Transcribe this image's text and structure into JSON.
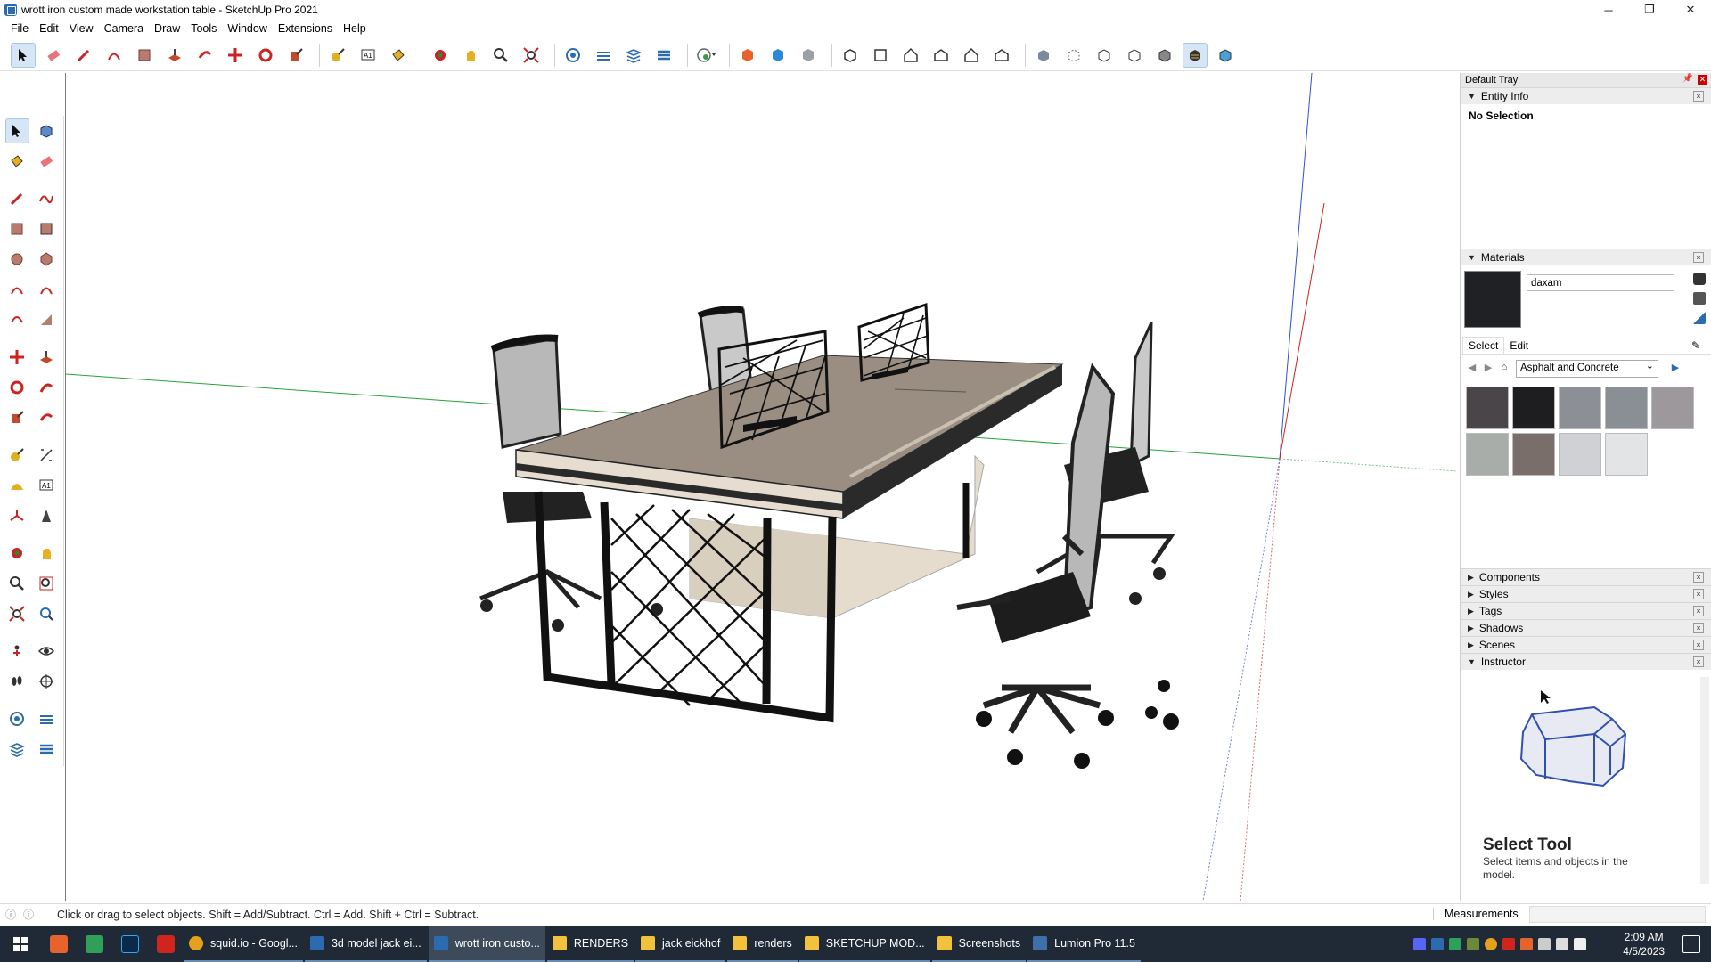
{
  "window": {
    "title": "wrott iron custom made workstation table - SketchUp Pro 2021",
    "controls": {
      "minimize": "─",
      "maximize": "❐",
      "close": "✕"
    }
  },
  "menu": [
    "File",
    "Edit",
    "View",
    "Camera",
    "Draw",
    "Tools",
    "Window",
    "Extensions",
    "Help"
  ],
  "tray": {
    "title": "Default Tray",
    "entity_info": {
      "title": "Entity Info",
      "selection": "No Selection"
    },
    "materials": {
      "title": "Materials",
      "name_value": "daxam",
      "tabs": [
        "Select",
        "Edit"
      ],
      "library": "Asphalt and Concrete",
      "swatch_colors": [
        "#4a4548",
        "#1e1e20",
        "#8c9096",
        "#8a8f95",
        "#9c989c",
        "#a9adaa",
        "#7a6e6a",
        "#cfd1d4",
        "#e3e4e6"
      ]
    },
    "collapsed_panels": [
      "Components",
      "Styles",
      "Tags",
      "Shadows",
      "Scenes"
    ],
    "instructor": {
      "title": "Instructor",
      "tool_title": "Select Tool",
      "tool_desc": "Select items and objects in the model."
    }
  },
  "status": {
    "hint": "Click or drag to select objects. Shift = Add/Subtract. Ctrl = Add. Shift + Ctrl = Subtract.",
    "measurements_label": "Measurements"
  },
  "taskbar": {
    "items": [
      {
        "label": "squid.io - Googl...",
        "color": "#e4a11b"
      },
      {
        "label": "3d model jack ei...",
        "color": "#2b6cb0"
      },
      {
        "label": "wrott iron custo...",
        "color": "#2b6cb0",
        "active": true
      },
      {
        "label": "RENDERS",
        "color": "#f3c23c"
      },
      {
        "label": "jack eickhof",
        "color": "#f3c23c"
      },
      {
        "label": "renders",
        "color": "#f3c23c"
      },
      {
        "label": "SKETCHUP MOD...",
        "color": "#f3c23c"
      },
      {
        "label": "Screenshots",
        "color": "#f3c23c"
      },
      {
        "label": "Lumion Pro 11.5",
        "color": "#3e6fa8"
      }
    ],
    "time": "2:09 AM",
    "date": "4/5/2023"
  }
}
